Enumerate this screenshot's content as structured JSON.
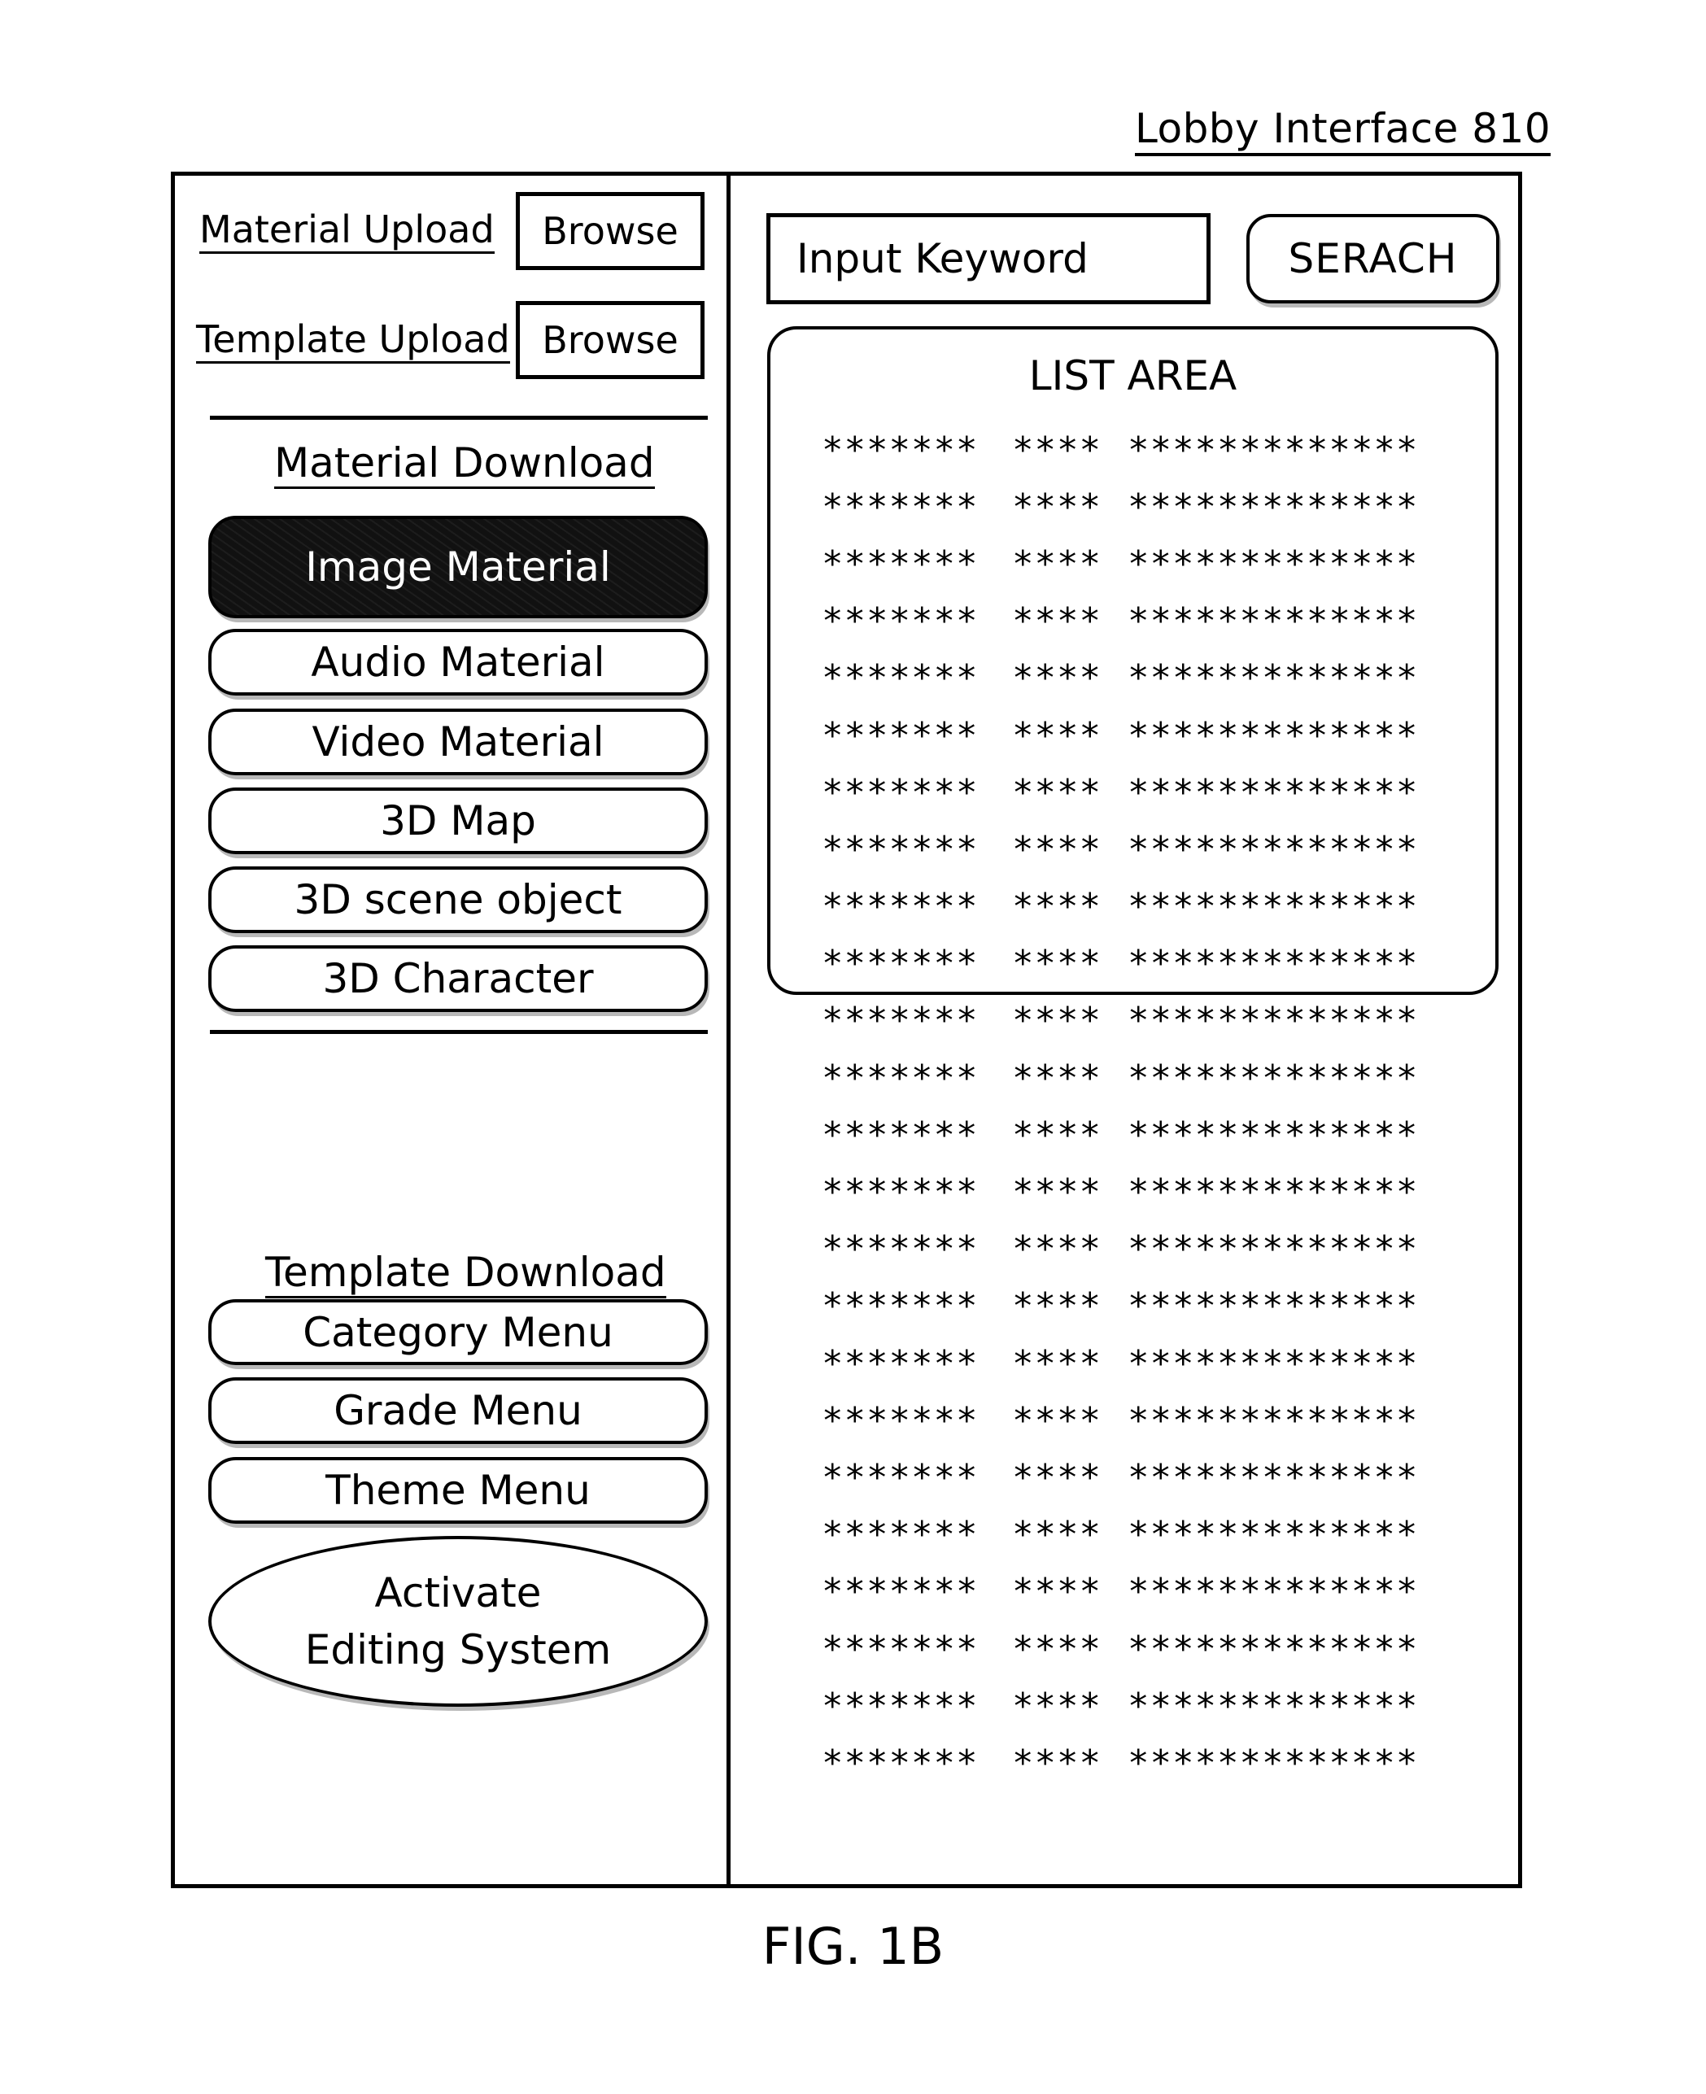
{
  "header": {
    "title": "Lobby Interface 810"
  },
  "upload": {
    "material_label": "Material Upload",
    "material_browse": "Browse",
    "template_label": "Template Upload",
    "template_browse": "Browse"
  },
  "material_download": {
    "heading": "Material Download",
    "items": [
      {
        "label": "Image Material",
        "selected": true
      },
      {
        "label": "Audio Material",
        "selected": false
      },
      {
        "label": "Video Material",
        "selected": false
      },
      {
        "label": "3D Map",
        "selected": false
      },
      {
        "label": "3D scene object",
        "selected": false
      },
      {
        "label": "3D Character",
        "selected": false
      }
    ]
  },
  "template_download": {
    "heading": "Template Download",
    "items": [
      {
        "label": "Category Menu"
      },
      {
        "label": "Grade Menu"
      },
      {
        "label": "Theme Menu"
      }
    ]
  },
  "activate": {
    "line1": "Activate",
    "line2": "Editing System"
  },
  "search": {
    "placeholder": "Input Keyword",
    "button": "SERACH"
  },
  "list_area": {
    "title": "LIST AREA",
    "rows": [
      [
        "*******",
        "****",
        "*************"
      ],
      [
        "*******",
        "****",
        "*************"
      ],
      [
        "*******",
        "****",
        "*************"
      ],
      [
        "*******",
        "****",
        "*************"
      ],
      [
        "*******",
        "****",
        "*************"
      ],
      [
        "*******",
        "****",
        "*************"
      ],
      [
        "*******",
        "****",
        "*************"
      ],
      [
        "*******",
        "****",
        "*************"
      ],
      [
        "*******",
        "****",
        "*************"
      ],
      [
        "*******",
        "****",
        "*************"
      ],
      [
        "*******",
        "****",
        "*************"
      ],
      [
        "*******",
        "****",
        "*************"
      ],
      [
        "*******",
        "****",
        "*************"
      ],
      [
        "*******",
        "****",
        "*************"
      ],
      [
        "*******",
        "****",
        "*************"
      ],
      [
        "*******",
        "****",
        "*************"
      ],
      [
        "*******",
        "****",
        "*************"
      ],
      [
        "*******",
        "****",
        "*************"
      ],
      [
        "*******",
        "****",
        "*************"
      ],
      [
        "*******",
        "****",
        "*************"
      ],
      [
        "*******",
        "****",
        "*************"
      ],
      [
        "*******",
        "****",
        "*************"
      ],
      [
        "*******",
        "****",
        "*************"
      ],
      [
        "*******",
        "****",
        "*************"
      ]
    ]
  },
  "caption": "FIG. 1B",
  "colors": {
    "ink": "#000000",
    "selected_fill": "#111111",
    "shadow": "#b8b8b8",
    "background": "#ffffff"
  }
}
